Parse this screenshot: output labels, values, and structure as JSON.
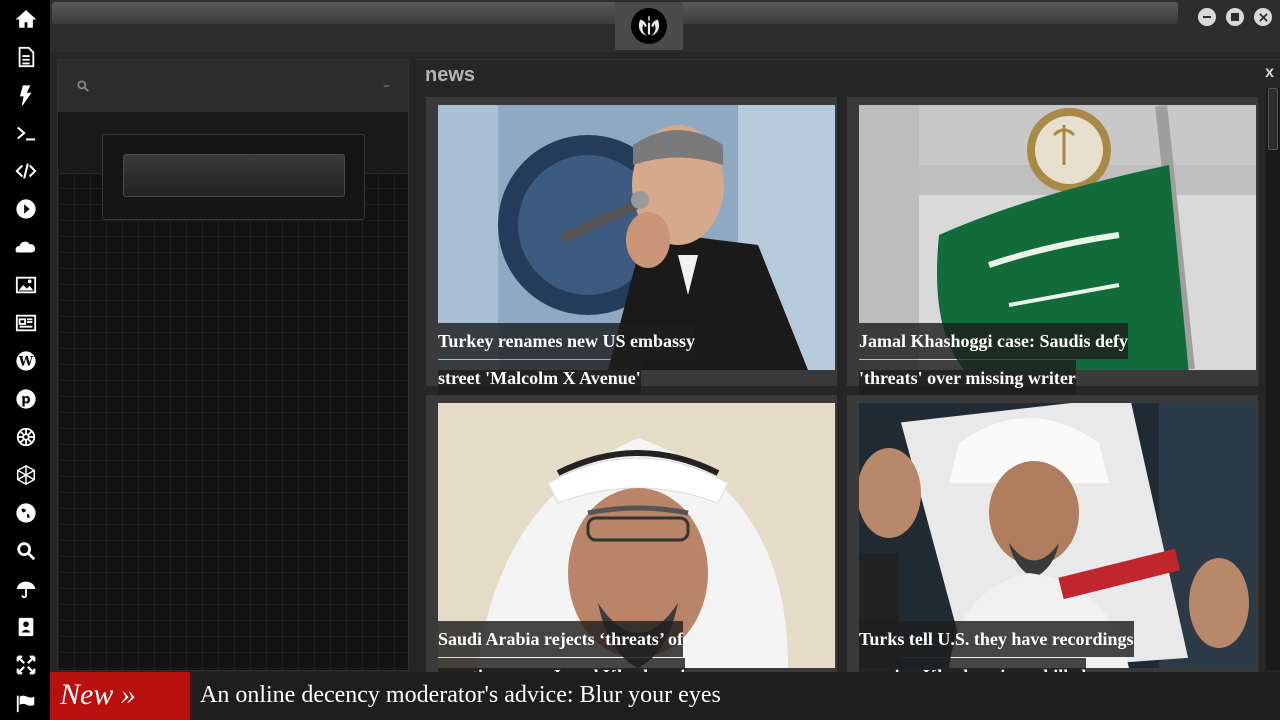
{
  "sidebar": {
    "icons": [
      "home-icon",
      "document-icon",
      "bolt-icon",
      "terminal-icon",
      "code-icon",
      "play-icon",
      "cloud-icon",
      "image-icon",
      "newspaper-icon",
      "wordpress-icon",
      "pinterest-icon",
      "empire-icon",
      "network-icon",
      "globe-icon",
      "search-icon",
      "umbrella-icon",
      "contacts-icon",
      "expand-icon",
      "flag-icon"
    ]
  },
  "news": {
    "title": "news",
    "close_label": "x",
    "articles": [
      {
        "headline": "Turkey renames new US embassy street 'Malcolm X Avenue'"
      },
      {
        "headline": "Jamal Khashoggi case: Saudis defy 'threats' over missing writer"
      },
      {
        "headline": "Saudi Arabia rejects ‘threats’ of sanctions over Jamal Khashoggi"
      },
      {
        "headline": "Turks tell U.S. they have recordings proving Khashoggi was killed"
      }
    ]
  },
  "ticker": {
    "label": "New »",
    "headline": "An online decency moderator's advice: Blur your eyes"
  },
  "colors": {
    "ticker_label_bg": "#b80f0f",
    "sidebar_bg": "#000000",
    "card_bg": "#3a3a3a"
  }
}
